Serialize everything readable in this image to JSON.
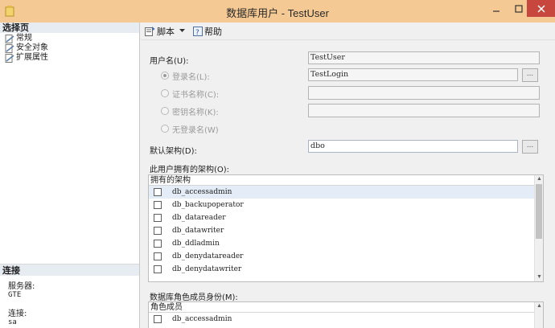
{
  "window": {
    "title": "数据库用户 - TestUser",
    "icons": [
      "app-icon",
      "minimize-icon",
      "maximize-icon",
      "close-icon"
    ]
  },
  "left_pane": {
    "select_page_header": "选择页",
    "pages": [
      {
        "label": "常规",
        "icon": "page-wrench-icon"
      },
      {
        "label": "安全对象",
        "icon": "page-wrench-icon"
      },
      {
        "label": "扩展属性",
        "icon": "page-wrench-icon"
      }
    ],
    "connection_header": "连接",
    "server_label": "服务器:",
    "server_value": "GTE",
    "connection_label": "连接:",
    "connection_value": "sa"
  },
  "toolbar": {
    "script_label": "脚本",
    "help_label": "帮助"
  },
  "form": {
    "username_label": "用户名(U):",
    "username_value": "TestUser",
    "login_name_label": "登录名(L):",
    "login_name_value": "TestLogin",
    "cert_name_label": "证书名称(C):",
    "key_name_label": "密钥名称(K):",
    "no_login_label": "无登录名(W)",
    "default_schema_label": "默认架构(D):",
    "default_schema_value": "dbo",
    "browse_button": "...",
    "owned_schemas_label": "此用户拥有的架构(O):",
    "owned_schemas_header": "拥有的架构",
    "owned_schemas": [
      "db_accessadmin",
      "db_backupoperator",
      "db_datareader",
      "db_datawriter",
      "db_ddladmin",
      "db_denydatareader",
      "db_denydatawriter"
    ],
    "role_membership_label": "数据库角色成员身份(M):",
    "role_membership_header": "角色成员",
    "roles": [
      "db_accessadmin"
    ]
  },
  "colors": {
    "titlebar": "#f4c993",
    "close_button": "#c7463d",
    "selected_row": "#e4edf7"
  }
}
